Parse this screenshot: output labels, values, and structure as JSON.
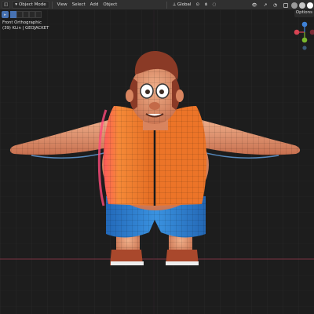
{
  "header": {
    "editor_type_icon": "3d-viewport-icon",
    "mode": "Object Mode",
    "menus": [
      "View",
      "Select",
      "Add",
      "Object"
    ],
    "orientation": "Global",
    "right_icons": [
      "viewport-visibility-icon",
      "gizmo-icon",
      "overlay-icon",
      "xray-icon",
      "shading-solid-icon",
      "shading-material-icon",
      "shading-rendered-icon"
    ]
  },
  "toolbar": {
    "options_label": "Options"
  },
  "viewport": {
    "view_name": "Front Orthographic",
    "collection_info": "(39) KLin | GEOJACKET",
    "colors": {
      "background": "#1d1d1d",
      "grid": "#2e2e2e",
      "x_axis": "#8a3a48",
      "skin": "#d88a66",
      "vest": "#f07a2c",
      "shorts": "#2b7fd0",
      "hair": "#8a3a26"
    }
  },
  "gizmo": {
    "axes": [
      "X",
      "Y",
      "Z"
    ],
    "colors": {
      "x": "#d94453",
      "y": "#7bb82c",
      "z": "#3f82d8"
    }
  }
}
